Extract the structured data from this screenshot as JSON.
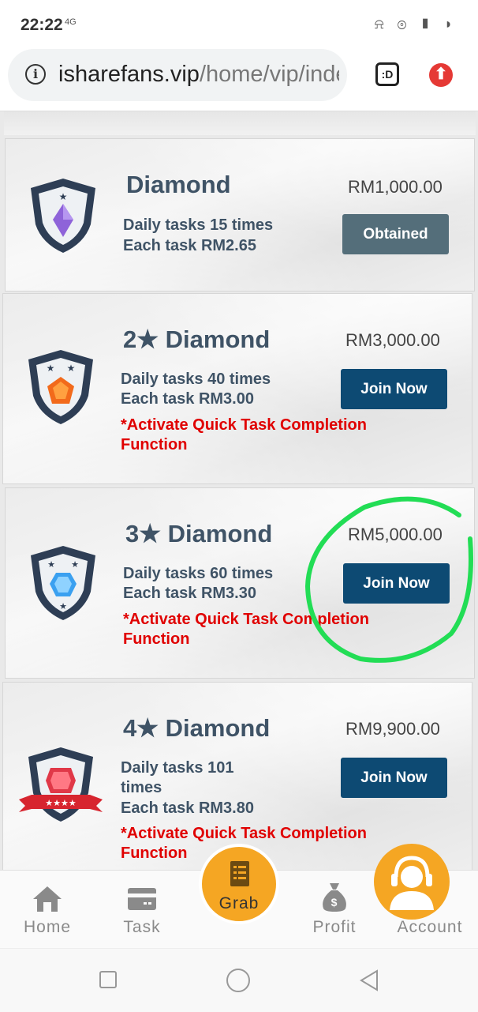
{
  "status_bar": {
    "time": "22:22",
    "signal": "4G"
  },
  "browser": {
    "url_host": "isharefans.vip",
    "url_path": "/home/vip/inde",
    "tab_label": ":D",
    "icons": [
      "info-icon",
      "tab-switcher-icon",
      "update-icon"
    ]
  },
  "plans": [
    {
      "title": "Diamond",
      "price": "RM1,000.00",
      "line1": "Daily tasks 15 times",
      "line2": "Each task RM2.65",
      "note": "",
      "button": "Obtained"
    },
    {
      "title": "2★ Diamond",
      "price": "RM3,000.00",
      "line1": "Daily tasks 40 times",
      "line2": "Each task RM3.00",
      "note1": "*Activate Quick Task Completion",
      "note2": "Function",
      "button": "Join Now"
    },
    {
      "title": "3★ Diamond",
      "price": "RM5,000.00",
      "line1": "Daily tasks 60 times",
      "line2": "Each task RM3.30",
      "note1": "*Activate Quick Task Completion",
      "note2": "Function",
      "button": "Join Now"
    },
    {
      "title": "4★ Diamond",
      "price": "RM9,900.00",
      "line1a": "Daily tasks 101",
      "line1b": "times",
      "line2": "Each task RM3.80",
      "note1": "*Activate Quick Task Completion",
      "note2": "Function",
      "button": "Join Now"
    }
  ],
  "nav": {
    "home": "Home",
    "task": "Task",
    "grab": "Grab",
    "profit": "Profit",
    "account": "Account"
  },
  "colors": {
    "join_button": "#0d4a73",
    "obtained_button": "#546e7a",
    "accent_orange": "#f5a623",
    "note_red": "#e00000",
    "highlight_green": "#22dd55"
  }
}
